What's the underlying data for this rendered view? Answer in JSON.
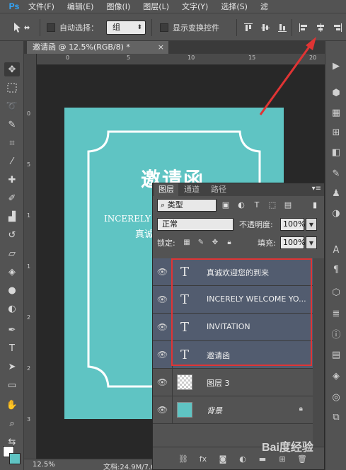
{
  "menubar": {
    "logo": "Ps",
    "items": [
      "文件(F)",
      "编辑(E)",
      "图像(I)",
      "图层(L)",
      "文字(Y)",
      "选择(S)",
      "滤"
    ]
  },
  "options": {
    "auto_select_label": "自动选择：",
    "auto_select_value": "组",
    "show_transform_label": "显示变换控件"
  },
  "document": {
    "tab_title": "邀请函 @ 12.5%(RGB/8) *",
    "close_glyph": "×",
    "zoom": "12.5%",
    "doc_info": "文档:24.9M/7.02M"
  },
  "rulers": {
    "h_labels": [
      "0",
      "5",
      "10",
      "15",
      "20"
    ],
    "v_labels": [
      "0",
      "5",
      "1",
      "1",
      "2",
      "2",
      "3"
    ]
  },
  "artboard": {
    "title": "邀请函",
    "english_line": "INCERELY WELCOME YOU",
    "chinese_line": "真诚欢迎您的到来",
    "english_visible": "INCERELY W",
    "chinese_visible": "真诚",
    "bg_color": "#5fc4c3"
  },
  "layers_panel": {
    "tabs": [
      "图层",
      "通道",
      "路径"
    ],
    "filter_label": "类型",
    "blend_mode": "正常",
    "opacity_label": "不透明度:",
    "opacity_value": "100%",
    "lock_label": "锁定:",
    "fill_label": "填充:",
    "fill_value": "100%",
    "layers": [
      {
        "name": "真诚欢迎您的到来",
        "kind": "text",
        "selected": true
      },
      {
        "name": "INCERELY WELCOME YO...",
        "kind": "text",
        "selected": true
      },
      {
        "name": "INVITATION",
        "kind": "text",
        "selected": true
      },
      {
        "name": "邀请函",
        "kind": "text",
        "selected": true
      },
      {
        "name": "图层 3",
        "kind": "pixel",
        "selected": false
      },
      {
        "name": "背景",
        "kind": "background",
        "selected": false
      }
    ],
    "text_layer_glyph": "T"
  },
  "colors": {
    "highlight": "#e03434",
    "foreground": "#ffffff",
    "background_swatch": "#5fc4c3",
    "selection": "#525c6f"
  },
  "icons": {
    "move_tool": "move-icon",
    "eye": "eye-icon",
    "lock": "lock-icon"
  },
  "watermark": "Bai度经验"
}
